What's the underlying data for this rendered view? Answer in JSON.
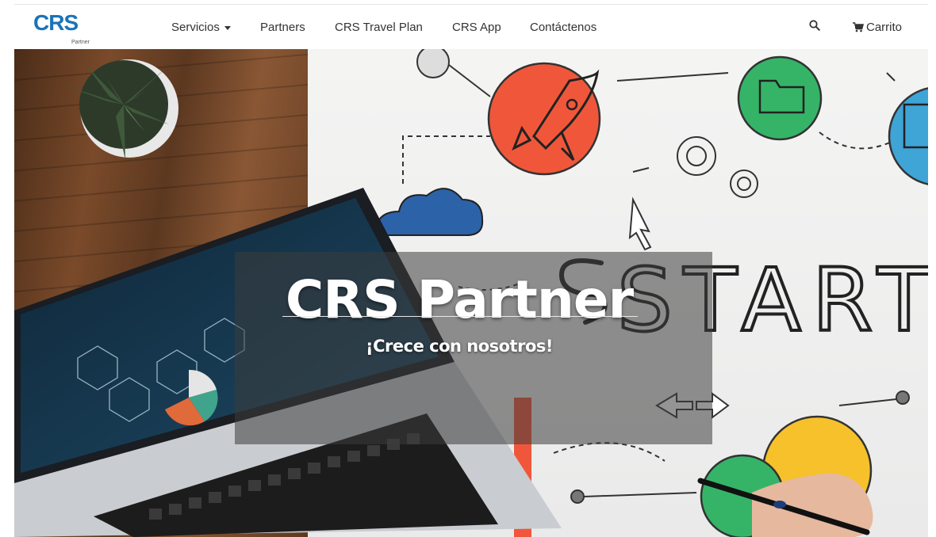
{
  "logo": {
    "main": "CRS",
    "sub": "Partner"
  },
  "nav": {
    "servicios": "Servicios",
    "partners": "Partners",
    "travel_plan": "CRS Travel Plan",
    "app": "CRS App",
    "contact": "Contáctenos",
    "cart": "Carrito"
  },
  "icons": {
    "search": "search-icon",
    "cart": "cart-icon",
    "dropdown": "caret-down-icon"
  },
  "hero": {
    "title": "CRS Partner",
    "subtitle": "¡Crece con nosotros!",
    "background_text": "START U"
  },
  "colors": {
    "brand": "#1a73b8",
    "nav_text": "#333333"
  }
}
